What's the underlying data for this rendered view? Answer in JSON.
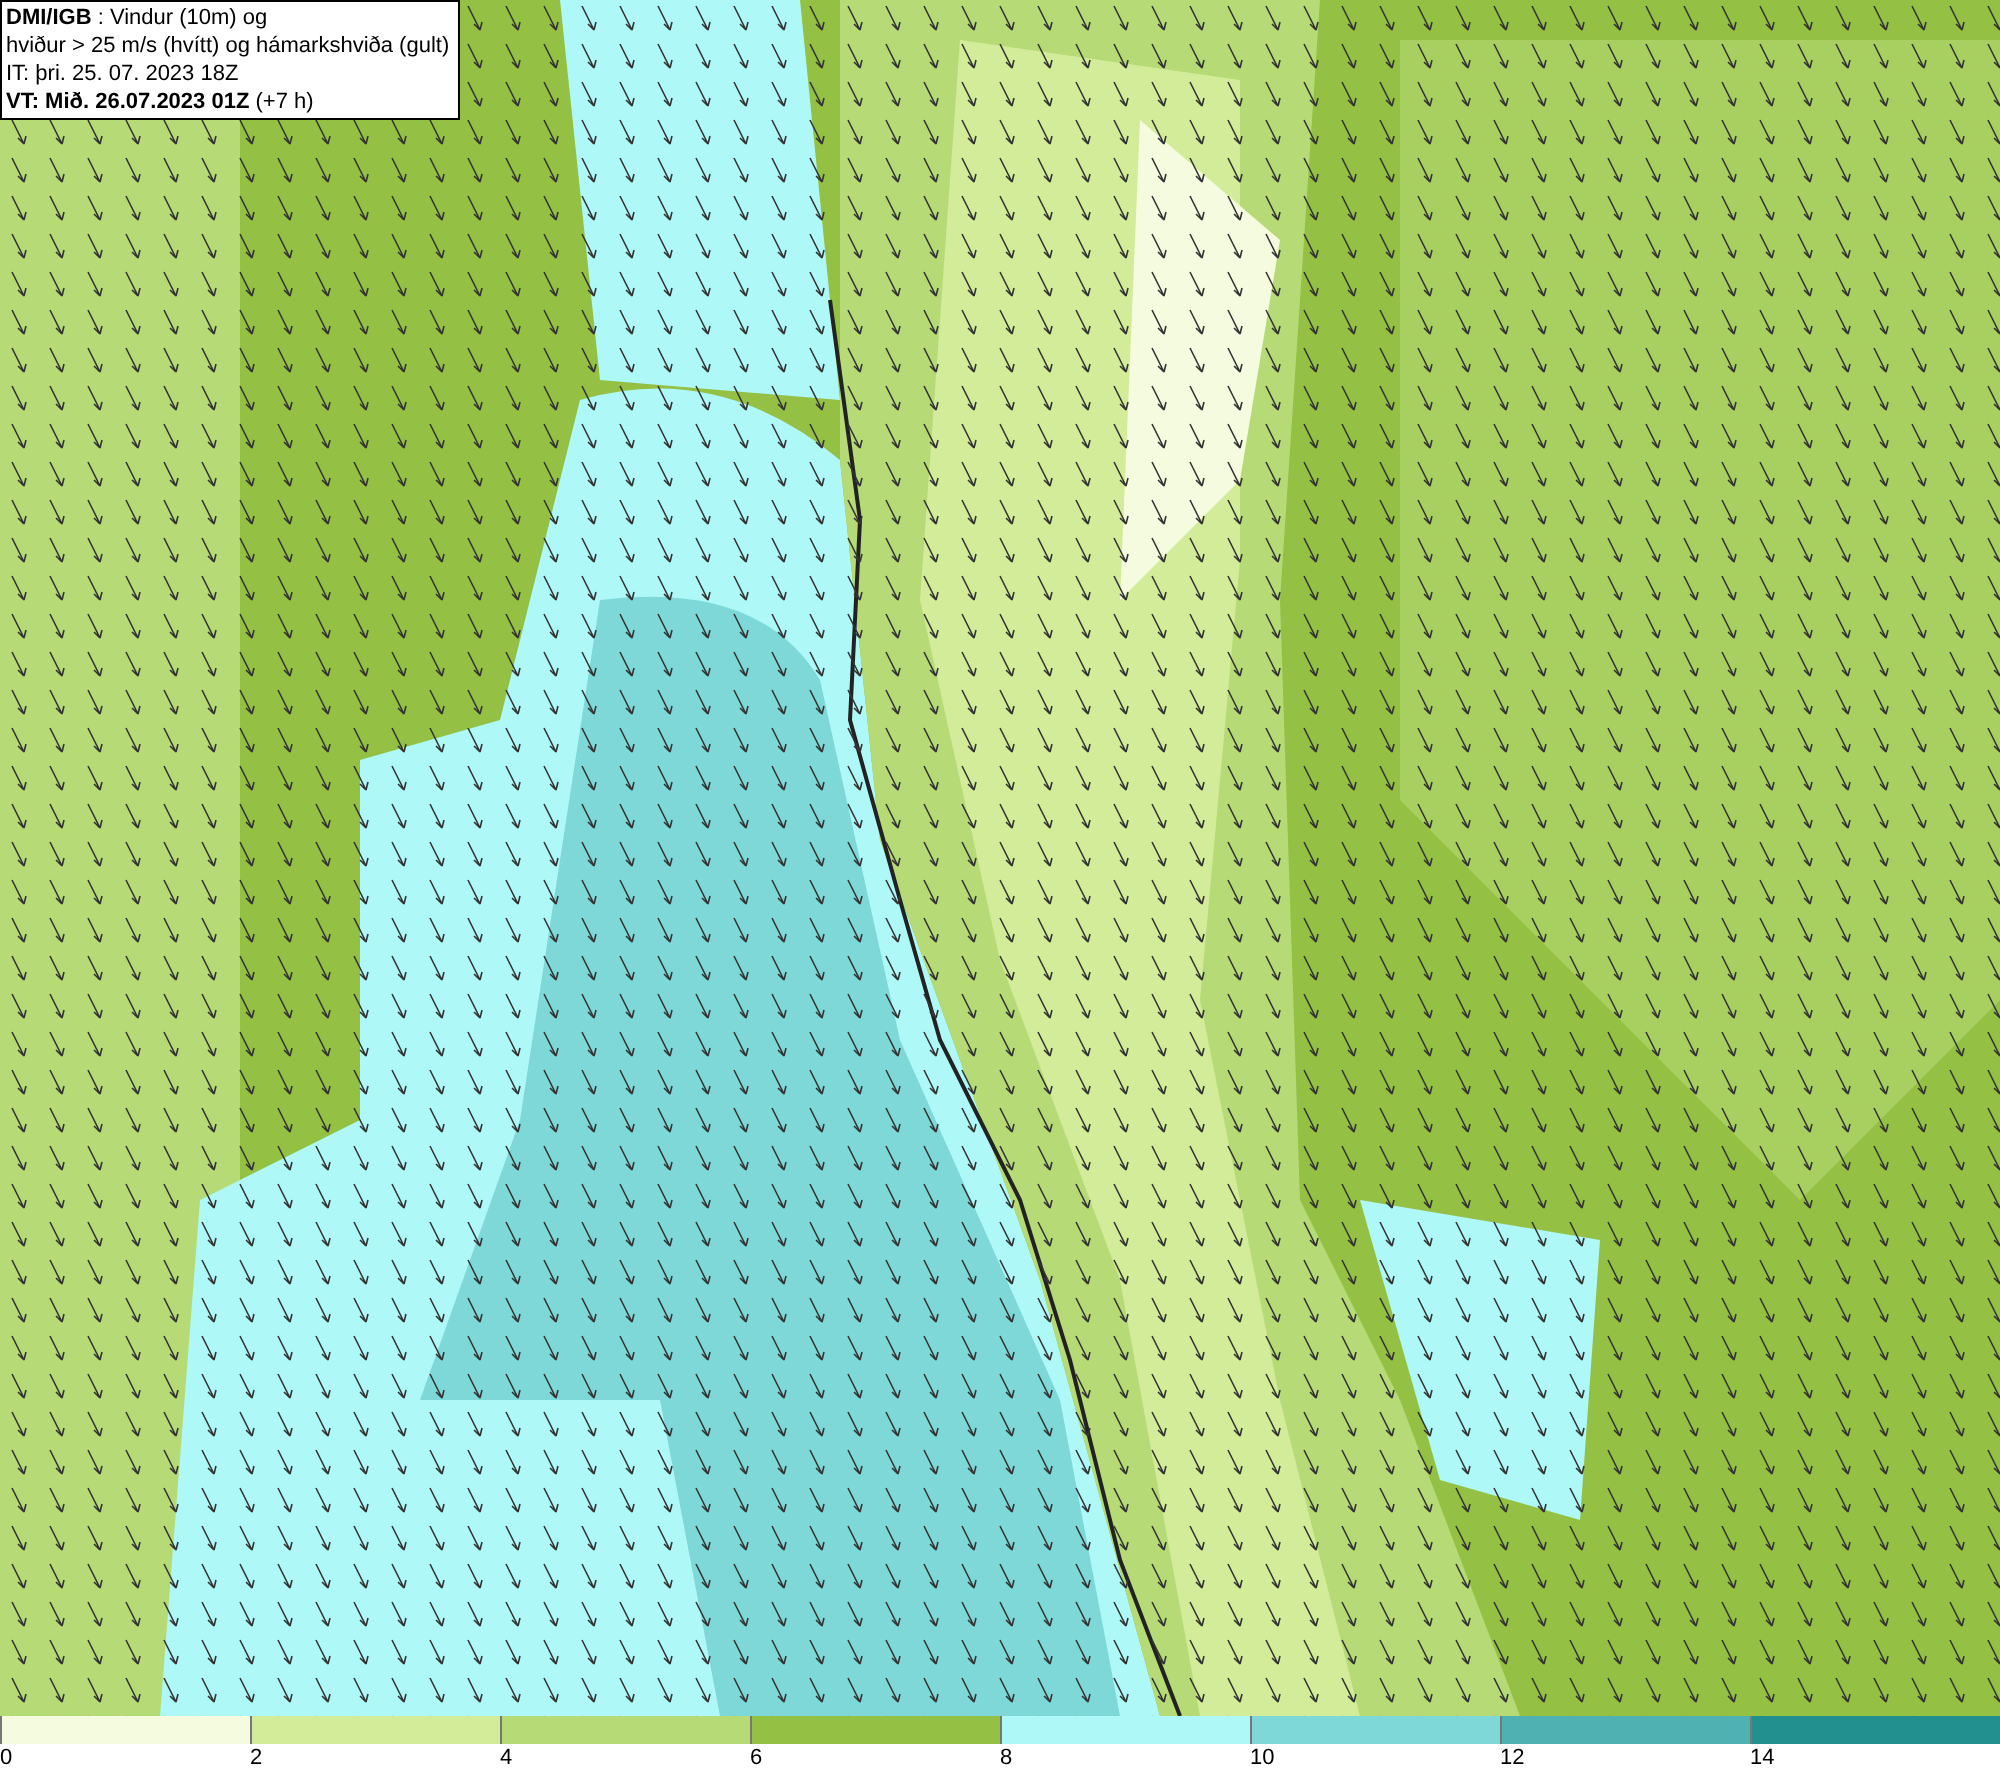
{
  "info_box": {
    "lines": [
      "**DMI/IGB** : Vindur (10m) og",
      "hviður > 25 m/s (hvítt) og hámarkshviða (gult)",
      "IT: þri. 25. 07. 2023 18Z",
      "**VT: Mið. 26.07.2023 01Z** (+7 h)"
    ]
  },
  "legend": [
    {
      "label": "0",
      "color": "#f5fbdf"
    },
    {
      "label": "2",
      "color": "#d3ec99"
    },
    {
      "label": "4",
      "color": "#b5da76"
    },
    {
      "label": "6",
      "color": "#94c043"
    },
    {
      "label": "8",
      "color": "#aef8f8"
    },
    {
      "label": "10",
      "color": "#7ed8d8"
    },
    {
      "label": "12",
      "color": "#4fb1b1"
    },
    {
      "label": "14",
      "color": "#21908f"
    }
  ]
}
